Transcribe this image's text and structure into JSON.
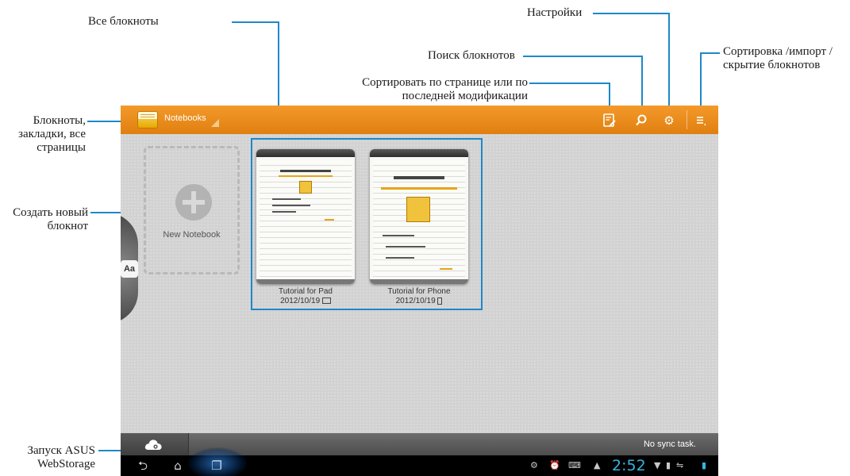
{
  "annotations": {
    "all_notebooks": "Все блокноты",
    "settings": "Настройки",
    "sort_import_hide": [
      "Сортировка /импорт /",
      "скрытие блокнотов"
    ],
    "search": "Поиск блокнотов",
    "sort_by_page": [
      "Сортировать по странице или по",
      "последней модификации"
    ],
    "notebooks_bookmarks": [
      "Блокноты,",
      "закладки, все",
      "страницы"
    ],
    "create_new": [
      "Создать новый",
      "блокнот"
    ],
    "launch_webstorage": [
      "Запуск ASUS",
      "WebStorage"
    ]
  },
  "colors": {
    "accent": "#1e88c8",
    "actionbar": "#f39a2a",
    "clock": "#33b5e5"
  },
  "actionbar": {
    "title": "Notebooks",
    "icons": [
      "notebook-app-icon",
      "sort-by-page-icon",
      "search-icon",
      "settings-gear-icon",
      "overflow-menu-icon"
    ]
  },
  "new_notebook": {
    "label": "New Notebook"
  },
  "notebooks": [
    {
      "title": "Tutorial for Pad",
      "date": "2012/10/19",
      "device_icon": "tablet-icon"
    },
    {
      "title": "Tutorial for Phone",
      "date": "2012/10/19",
      "device_icon": "phone-icon"
    }
  ],
  "sync": {
    "status": "No sync task."
  },
  "statusbar": {
    "time": "2:52"
  }
}
